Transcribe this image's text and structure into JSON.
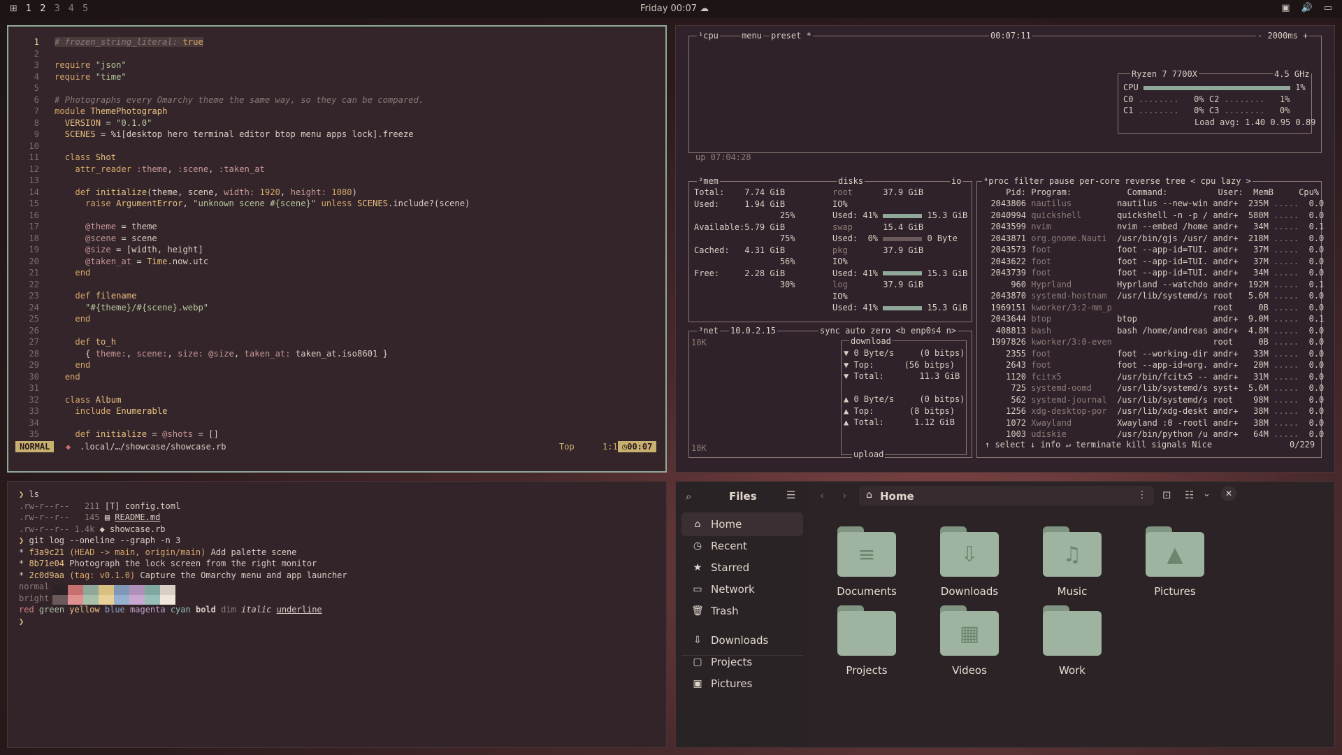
{
  "topbar": {
    "workspaces": [
      "1",
      "2",
      "3",
      "4",
      "5"
    ],
    "clock": "Friday 00:07"
  },
  "nvim": {
    "lines": [
      {
        "n": "1",
        "html": "<span class=\"curline\"><span class=\"cmt\"># frozen_string_literal:</span> <span class=\"kw\">true</span></span>"
      },
      {
        "n": "2",
        "html": ""
      },
      {
        "n": "3",
        "html": "<span class=\"kw\">require</span> <span class=\"str\">\"json\"</span>"
      },
      {
        "n": "4",
        "html": "<span class=\"kw\">require</span> <span class=\"str\">\"time\"</span>"
      },
      {
        "n": "5",
        "html": ""
      },
      {
        "n": "6",
        "html": "<span class=\"cmt\"># Photographs every Omarchy theme the same way, so they can be compared.</span>"
      },
      {
        "n": "7",
        "html": "<span class=\"kw\">module</span> <span class=\"cls\">ThemePhotograph</span>"
      },
      {
        "n": "8",
        "html": "  <span class=\"cls\">VERSION</span> = <span class=\"str\">\"0.1.0\"</span>"
      },
      {
        "n": "9",
        "html": "  <span class=\"cls\">SCENES</span> = %i[desktop hero terminal editor btop menu apps lock].freeze"
      },
      {
        "n": "10",
        "html": ""
      },
      {
        "n": "11",
        "html": "  <span class=\"kw\">class</span> <span class=\"cls\">Shot</span>"
      },
      {
        "n": "12",
        "html": "    <span class=\"kw\">attr_reader</span> <span class=\"iv\">:theme</span>, <span class=\"iv\">:scene</span>, <span class=\"iv\">:taken_at</span>"
      },
      {
        "n": "13",
        "html": ""
      },
      {
        "n": "14",
        "html": "    <span class=\"kw\">def</span> <span class=\"cls\">initialize</span>(theme, scene, <span class=\"iv\">width:</span> <span class=\"kw\">1920</span>, <span class=\"iv\">height:</span> <span class=\"kw\">1080</span>)"
      },
      {
        "n": "15",
        "html": "      <span class=\"kw\">raise</span> <span class=\"cls\">ArgumentError</span>, <span class=\"str\">\"unknown scene #{scene}\"</span> <span class=\"kw\">unless</span> <span class=\"cls\">SCENES</span>.include?(scene)"
      },
      {
        "n": "16",
        "html": ""
      },
      {
        "n": "17",
        "html": "      <span class=\"iv\">@theme</span> = theme"
      },
      {
        "n": "18",
        "html": "      <span class=\"iv\">@scene</span> = scene"
      },
      {
        "n": "19",
        "html": "      <span class=\"iv\">@size</span> = [width, height]"
      },
      {
        "n": "20",
        "html": "      <span class=\"iv\">@taken_at</span> = <span class=\"cls\">Time</span>.now.utc"
      },
      {
        "n": "21",
        "html": "    <span class=\"kw\">end</span>"
      },
      {
        "n": "22",
        "html": ""
      },
      {
        "n": "23",
        "html": "    <span class=\"kw\">def</span> <span class=\"cls\">filename</span>"
      },
      {
        "n": "24",
        "html": "      <span class=\"str\">\"#{theme}/#{scene}.webp\"</span>"
      },
      {
        "n": "25",
        "html": "    <span class=\"kw\">end</span>"
      },
      {
        "n": "26",
        "html": ""
      },
      {
        "n": "27",
        "html": "    <span class=\"kw\">def</span> <span class=\"cls\">to_h</span>"
      },
      {
        "n": "28",
        "html": "      { <span class=\"iv\">theme:</span>, <span class=\"iv\">scene:</span>, <span class=\"iv\">size:</span> <span class=\"iv\">@size</span>, <span class=\"iv\">taken_at:</span> taken_at.iso8601 }"
      },
      {
        "n": "29",
        "html": "    <span class=\"kw\">end</span>"
      },
      {
        "n": "30",
        "html": "  <span class=\"kw\">end</span>"
      },
      {
        "n": "31",
        "html": ""
      },
      {
        "n": "32",
        "html": "  <span class=\"kw\">class</span> <span class=\"cls\">Album</span>"
      },
      {
        "n": "33",
        "html": "    <span class=\"kw\">include</span> <span class=\"cls\">Enumerable</span>"
      },
      {
        "n": "34",
        "html": ""
      },
      {
        "n": "35",
        "html": "    <span class=\"kw\">def</span> <span class=\"cls\">initialize</span> = <span class=\"iv\">@shots</span> = []"
      }
    ],
    "status": {
      "mode": "NORMAL",
      "file": ".local/…/showcase/showcase.rb",
      "pos": "Top",
      "lncol": "1:1",
      "time": "00:07"
    }
  },
  "btop": {
    "cpu": {
      "label": "¹cpu",
      "menu": "menu",
      "preset": "preset *",
      "time": "00:07:11",
      "rate": "- 2000ms +",
      "model": "Ryzen 7 7700X",
      "freq": "4.5 GHz",
      "cpu_pct": "1%",
      "c0": "0%",
      "c1": "0%",
      "c2": "1%",
      "c3": "0%",
      "load": "Load avg: 1.40 0.95 0.89",
      "uptime": "up 07:04:28"
    },
    "mem": {
      "label": "²mem",
      "total": "7.74 GiB",
      "used": "1.94 GiB",
      "used_pct": "25%",
      "available": "5.79 GiB",
      "avail_pct": "75%",
      "cached": "4.31 GiB",
      "cached_pct": "56%",
      "free": "2.28 GiB",
      "free_pct": "30%"
    },
    "disks": {
      "label": "disks",
      "io": "io",
      "root": "37.9 GiB",
      "root_used": "15.3 GiB",
      "swap": "15.4 GiB",
      "swap_used": "0 Byte",
      "pkg": "37.9 GiB",
      "pkg_used": "15.3 GiB",
      "log": "37.9 GiB",
      "log_used": "15.3 GiB"
    },
    "net": {
      "label": "³net",
      "ip": "10.0.2.15",
      "opts": "sync auto zero <b enp0s4 n>",
      "scale": "10K",
      "dl_rate": "0 Byte/s",
      "dl_bits": "(0 bitps)",
      "dl_top": "(56 bitps)",
      "dl_total": "11.3 GiB",
      "ul_rate": "0 Byte/s",
      "ul_bits": "(0 bitps)",
      "ul_top": "(8 bitps)",
      "ul_total": "1.12 GiB"
    },
    "proc": {
      "header": "⁴proc filter        pause per-core reverse tree < cpu lazy >",
      "cols": "     Pid: Program:           Command:          User:  MemB     Cpu%",
      "rows": [
        [
          "2043806",
          "nautilus",
          "nautilus --new-win",
          "andr+",
          "235M",
          "0.0"
        ],
        [
          "2040994",
          "quickshell",
          "quickshell -n -p /",
          "andr+",
          "580M",
          "0.0"
        ],
        [
          "2043599",
          "nvim",
          "nvim --embed /home",
          "andr+",
          "34M",
          "0.1"
        ],
        [
          "2043871",
          "org.gnome.Nauti",
          "/usr/bin/gjs /usr/",
          "andr+",
          "218M",
          "0.0"
        ],
        [
          "2043573",
          "foot",
          "foot --app-id=TUI.",
          "andr+",
          "37M",
          "0.0"
        ],
        [
          "2043622",
          "foot",
          "foot --app-id=TUI.",
          "andr+",
          "37M",
          "0.0"
        ],
        [
          "2043739",
          "foot",
          "foot --app-id=TUI.",
          "andr+",
          "34M",
          "0.0"
        ],
        [
          "960",
          "Hyprland",
          "Hyprland --watchdo",
          "andr+",
          "192M",
          "0.1"
        ],
        [
          "2043870",
          "systemd-hostnam",
          "/usr/lib/systemd/s",
          "root",
          "5.6M",
          "0.0"
        ],
        [
          "1969151",
          "kworker/3:2-mm_p",
          "",
          "root",
          "0B",
          "0.0"
        ],
        [
          "2043644",
          "btop",
          "btop",
          "andr+",
          "9.0M",
          "0.1"
        ],
        [
          "408813",
          "bash",
          "bash /home/andreas",
          "andr+",
          "4.8M",
          "0.0"
        ],
        [
          "1997826",
          "kworker/3:0-even",
          "",
          "root",
          "0B",
          "0.0"
        ],
        [
          "2355",
          "foot",
          "foot --working-dir",
          "andr+",
          "33M",
          "0.0"
        ],
        [
          "2643",
          "foot",
          "foot --app-id=org.",
          "andr+",
          "20M",
          "0.0"
        ],
        [
          "1120",
          "fcitx5",
          "/usr/bin/fcitx5 --",
          "andr+",
          "31M",
          "0.0"
        ],
        [
          "725",
          "systemd-oomd",
          "/usr/lib/systemd/s",
          "syst+",
          "5.6M",
          "0.0"
        ],
        [
          "562",
          "systemd-journal",
          "/usr/lib/systemd/s",
          "root",
          "98M",
          "0.0"
        ],
        [
          "1256",
          "xdg-desktop-por",
          "/usr/lib/xdg-deskt",
          "andr+",
          "38M",
          "0.0"
        ],
        [
          "1072",
          "Xwayland",
          "Xwayland :0 -rootl",
          "andr+",
          "38M",
          "0.0"
        ],
        [
          "1003",
          "udiskie",
          "/usr/bin/python /u",
          "andr+",
          "64M",
          "0.0"
        ]
      ],
      "footer": "↑ select ↓ info ↵ terminate kill signals Nice",
      "count": "0/229"
    }
  },
  "term": {
    "lines": [
      "<span class=\"cls\">❯</span> ls",
      "<span class=\"muted\">.rw-r--r--   211</span> [T] config.toml",
      "<span class=\"muted\">.rw-r--r--   145</span> ▤ <span style=\"text-decoration:underline\">README.md</span>",
      "<span class=\"muted\">.rw-r--r-- 1.4k</span> ◆ showcase.rb",
      "<span class=\"cls\">❯</span> git log --oneline --graph -n 3",
      "* <span class=\"cls\">f3a9c21</span> <span class=\"kw\">(HEAD -> main, origin/main)</span> Add palette scene",
      "* <span class=\"cls\">8b71e04</span> Photograph the lock screen from the right monitor",
      "* <span class=\"cls\">2c0d9aa</span> <span class=\"kw\">(tag: v0.1.0)</span> Capture the Omarchy menu and app launcher",
      "<span class=\"muted\">normal</span>",
      "<span class=\"muted\">bright</span>",
      "<span style=\"color:#d08080\">red</span> <span class=\"green\">green</span> <span class=\"cls\">yellow</span> <span style=\"color:#90a8c8\">blue</span> <span style=\"color:#c0a0c8\">magenta</span> <span style=\"color:#90c0b8\">cyan</span> <b>bold</b> <span class=\"muted\">dim</span> <i>italic</i> <span style=\"text-decoration:underline\">underline</span>",
      "<span class=\"cls\">❯</span>"
    ],
    "palette": [
      "#2c2326",
      "#c87070",
      "#8fa89a",
      "#d8c080",
      "#8098b8",
      "#b090b8",
      "#80a8a0",
      "#d8cfc4"
    ],
    "bright": [
      "#6a5a5a",
      "#e09090",
      "#a8c0a8",
      "#e8d098",
      "#98b0d0",
      "#c8a8d0",
      "#98c0b8",
      "#efe6dc"
    ]
  },
  "files": {
    "title": "Files",
    "path": "Home",
    "sidebar": [
      {
        "label": "Home",
        "icon": "home-icon",
        "glyph": "⌂",
        "sel": true
      },
      {
        "label": "Recent",
        "icon": "clock-icon",
        "glyph": "◷"
      },
      {
        "label": "Starred",
        "icon": "star-icon",
        "glyph": "★"
      },
      {
        "label": "Network",
        "icon": "network-icon",
        "glyph": "▭"
      },
      {
        "label": "Trash",
        "icon": "trash-icon",
        "glyph": "🗑"
      },
      {
        "label": "Downloads",
        "icon": "download-icon",
        "glyph": "⇩"
      },
      {
        "label": "Projects",
        "icon": "folder-icon",
        "glyph": "▢"
      },
      {
        "label": "Pictures",
        "icon": "image-icon",
        "glyph": "▣"
      }
    ],
    "folders": [
      {
        "label": "Documents",
        "icon": "document-icon",
        "glyph": "≡"
      },
      {
        "label": "Downloads",
        "icon": "download-icon",
        "glyph": "⇩"
      },
      {
        "label": "Music",
        "icon": "music-icon",
        "glyph": "♫"
      },
      {
        "label": "Pictures",
        "icon": "picture-icon",
        "glyph": "▲"
      },
      {
        "label": "Projects",
        "icon": "folder-icon",
        "glyph": ""
      },
      {
        "label": "Videos",
        "icon": "film-icon",
        "glyph": "▦"
      },
      {
        "label": "Work",
        "icon": "folder-icon",
        "glyph": ""
      }
    ]
  }
}
